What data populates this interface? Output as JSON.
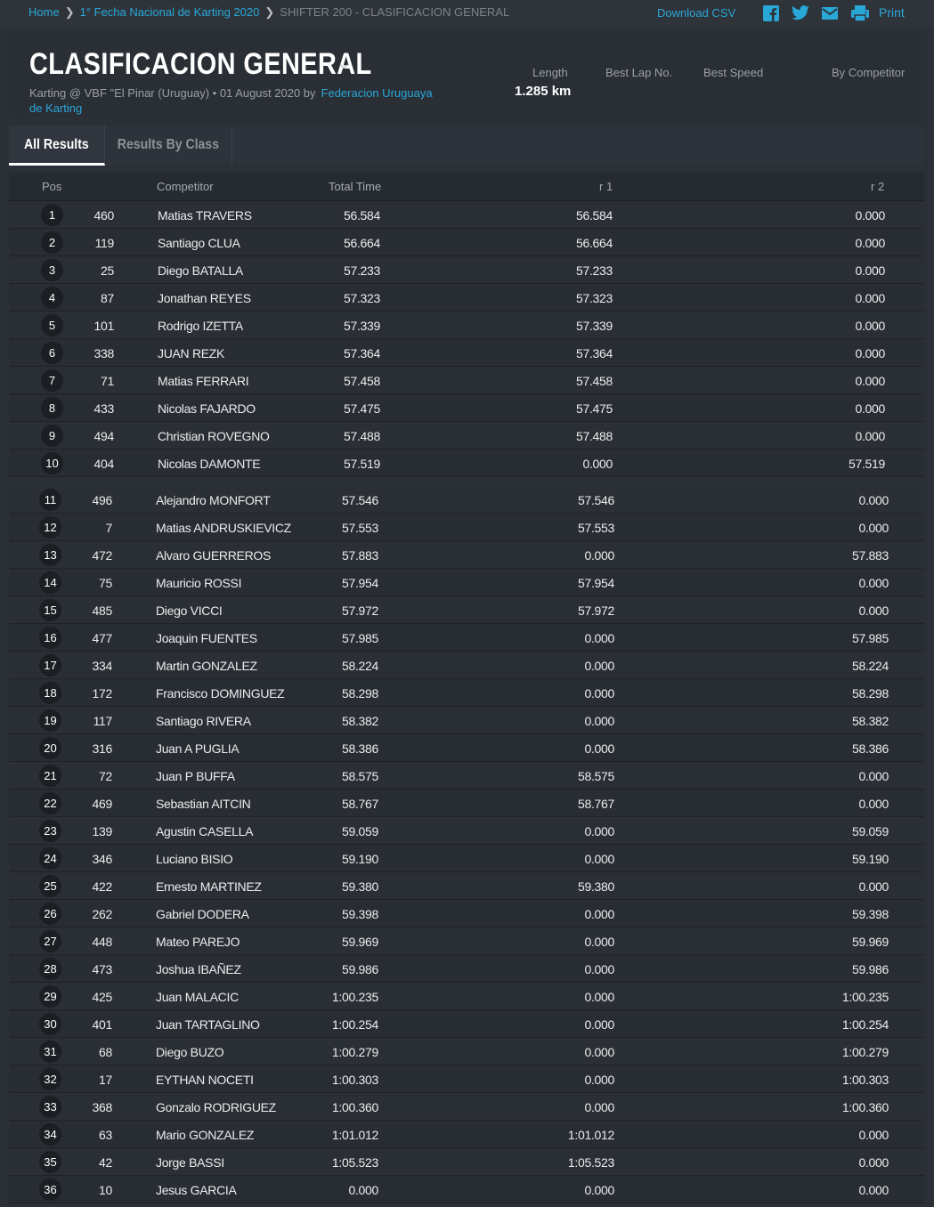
{
  "breadcrumb": {
    "home": "Home",
    "event": "1° Fecha Nacional de Karting 2020",
    "current": "SHIFTER 200 - CLASIFICACION GENERAL"
  },
  "actions": {
    "download_csv": "Download CSV",
    "print": "Print",
    "icons": [
      "facebook-icon",
      "twitter-icon",
      "mail-icon",
      "print-icon"
    ]
  },
  "header": {
    "title": "CLASIFICACION GENERAL",
    "subtitle_prefix": "Karting @ VBF \"El Pinar (Uruguay) • 01 August 2020 by",
    "organizer": "Federacion Uruguaya de Karting",
    "length_label": "Length",
    "length_value": "1.285 km",
    "best_lap_label": "Best Lap No.",
    "best_speed_label": "Best Speed",
    "by_competitor_label": "By Competitor"
  },
  "tabs": [
    {
      "label": "All Results",
      "active": true
    },
    {
      "label": "Results By Class",
      "active": false
    }
  ],
  "colors": {
    "accent": "#29a8d8",
    "background": "#2b2f36",
    "text": "#e8e8e8"
  },
  "table": {
    "columns": [
      "Pos",
      "Competitor",
      "Total Time",
      "r 1",
      "r 2"
    ],
    "rows": [
      {
        "pos": "1",
        "no": "460",
        "name": "Matias TRAVERS",
        "total": "56.584",
        "r1": "56.584",
        "r2": "0.000"
      },
      {
        "pos": "2",
        "no": "119",
        "name": "Santiago CLUA",
        "total": "56.664",
        "r1": "56.664",
        "r2": "0.000"
      },
      {
        "pos": "3",
        "no": "25",
        "name": "Diego BATALLA",
        "total": "57.233",
        "r1": "57.233",
        "r2": "0.000"
      },
      {
        "pos": "4",
        "no": "87",
        "name": "Jonathan REYES",
        "total": "57.323",
        "r1": "57.323",
        "r2": "0.000"
      },
      {
        "pos": "5",
        "no": "101",
        "name": "Rodrigo IZETTA",
        "total": "57.339",
        "r1": "57.339",
        "r2": "0.000"
      },
      {
        "pos": "6",
        "no": "338",
        "name": "JUAN REZK",
        "total": "57.364",
        "r1": "57.364",
        "r2": "0.000"
      },
      {
        "pos": "7",
        "no": "71",
        "name": "Matias FERRARI",
        "total": "57.458",
        "r1": "57.458",
        "r2": "0.000"
      },
      {
        "pos": "8",
        "no": "433",
        "name": "Nicolas FAJARDO",
        "total": "57.475",
        "r1": "57.475",
        "r2": "0.000"
      },
      {
        "pos": "9",
        "no": "494",
        "name": "Christian ROVEGNO",
        "total": "57.488",
        "r1": "57.488",
        "r2": "0.000"
      },
      {
        "pos": "10",
        "no": "404",
        "name": "Nicolas DAMONTE",
        "total": "57.519",
        "r1": "0.000",
        "r2": "57.519"
      },
      {
        "pos": "11",
        "no": "496",
        "name": "Alejandro MONFORT",
        "total": "57.546",
        "r1": "57.546",
        "r2": "0.000"
      },
      {
        "pos": "12",
        "no": "7",
        "name": "Matias ANDRUSKIEVICZ",
        "total": "57.553",
        "r1": "57.553",
        "r2": "0.000"
      },
      {
        "pos": "13",
        "no": "472",
        "name": "Alvaro GUERREROS",
        "total": "57.883",
        "r1": "0.000",
        "r2": "57.883"
      },
      {
        "pos": "14",
        "no": "75",
        "name": "Mauricio ROSSI",
        "total": "57.954",
        "r1": "57.954",
        "r2": "0.000"
      },
      {
        "pos": "15",
        "no": "485",
        "name": "Diego VICCI",
        "total": "57.972",
        "r1": "57.972",
        "r2": "0.000"
      },
      {
        "pos": "16",
        "no": "477",
        "name": "Joaquin FUENTES",
        "total": "57.985",
        "r1": "0.000",
        "r2": "57.985"
      },
      {
        "pos": "17",
        "no": "334",
        "name": "Martin GONZALEZ",
        "total": "58.224",
        "r1": "0.000",
        "r2": "58.224"
      },
      {
        "pos": "18",
        "no": "172",
        "name": "Francisco DOMINGUEZ",
        "total": "58.298",
        "r1": "0.000",
        "r2": "58.298"
      },
      {
        "pos": "19",
        "no": "117",
        "name": "Santiago RIVERA",
        "total": "58.382",
        "r1": "0.000",
        "r2": "58.382"
      },
      {
        "pos": "20",
        "no": "316",
        "name": "Juan A PUGLIA",
        "total": "58.386",
        "r1": "0.000",
        "r2": "58.386"
      },
      {
        "pos": "21",
        "no": "72",
        "name": "Juan P BUFFA",
        "total": "58.575",
        "r1": "58.575",
        "r2": "0.000"
      },
      {
        "pos": "22",
        "no": "469",
        "name": "Sebastian AITCIN",
        "total": "58.767",
        "r1": "58.767",
        "r2": "0.000"
      },
      {
        "pos": "23",
        "no": "139",
        "name": "Agustin CASELLA",
        "total": "59.059",
        "r1": "0.000",
        "r2": "59.059"
      },
      {
        "pos": "24",
        "no": "346",
        "name": "Luciano BISIO",
        "total": "59.190",
        "r1": "0.000",
        "r2": "59.190"
      },
      {
        "pos": "25",
        "no": "422",
        "name": "Ernesto MARTINEZ",
        "total": "59.380",
        "r1": "59.380",
        "r2": "0.000"
      },
      {
        "pos": "26",
        "no": "262",
        "name": "Gabriel DODERA",
        "total": "59.398",
        "r1": "0.000",
        "r2": "59.398"
      },
      {
        "pos": "27",
        "no": "448",
        "name": "Mateo PAREJO",
        "total": "59.969",
        "r1": "0.000",
        "r2": "59.969"
      },
      {
        "pos": "28",
        "no": "473",
        "name": "Joshua IBAÑEZ",
        "total": "59.986",
        "r1": "0.000",
        "r2": "59.986"
      },
      {
        "pos": "29",
        "no": "425",
        "name": "Juan MALACIC",
        "total": "1:00.235",
        "r1": "0.000",
        "r2": "1:00.235"
      },
      {
        "pos": "30",
        "no": "401",
        "name": "Juan TARTAGLINO",
        "total": "1:00.254",
        "r1": "0.000",
        "r2": "1:00.254"
      },
      {
        "pos": "31",
        "no": "68",
        "name": "Diego BUZO",
        "total": "1:00.279",
        "r1": "0.000",
        "r2": "1:00.279"
      },
      {
        "pos": "32",
        "no": "17",
        "name": "EYTHAN NOCETI",
        "total": "1:00.303",
        "r1": "0.000",
        "r2": "1:00.303"
      },
      {
        "pos": "33",
        "no": "368",
        "name": "Gonzalo RODRIGUEZ",
        "total": "1:00.360",
        "r1": "0.000",
        "r2": "1:00.360"
      },
      {
        "pos": "34",
        "no": "63",
        "name": "Mario GONZALEZ",
        "total": "1:01.012",
        "r1": "1:01.012",
        "r2": "0.000"
      },
      {
        "pos": "35",
        "no": "42",
        "name": "Jorge BASSI",
        "total": "1:05.523",
        "r1": "1:05.523",
        "r2": "0.000"
      },
      {
        "pos": "36",
        "no": "10",
        "name": "Jesus GARCIA",
        "total": "0.000",
        "r1": "0.000",
        "r2": "0.000"
      }
    ]
  }
}
